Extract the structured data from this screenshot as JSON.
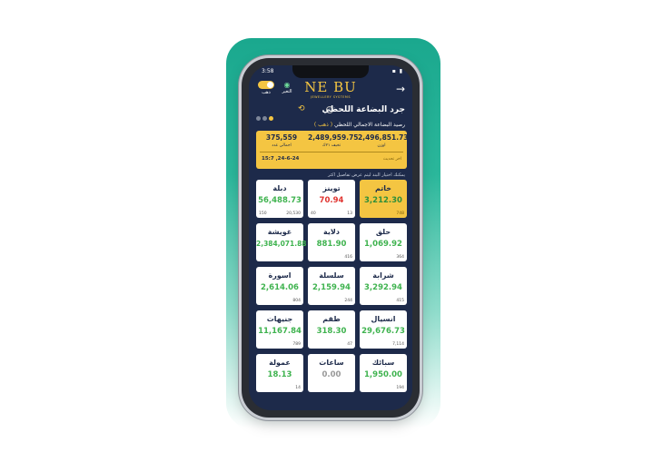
{
  "status": {
    "time": "3:58",
    "icons": "▪ ▮"
  },
  "header": {
    "logo": "NE BU",
    "logo_sub": "JEWELLERY SYSTEMS",
    "eye_label": "التغير",
    "toggle_label": "ذهب",
    "arrow": "→"
  },
  "title": {
    "text": "جرد البضاعة اللحظي",
    "info": "i"
  },
  "subtitle": {
    "text": "رصيد البضاعة الاجمالي اللحظي",
    "highlight": "( ذهب )"
  },
  "summary": {
    "stats": [
      {
        "value": "2,496,851.73",
        "label": "اوزن"
      },
      {
        "value": "2,489,959.75",
        "label": "تخيف ٢١ك"
      },
      {
        "value": "375,559",
        "label": "اجمالي عدد"
      }
    ],
    "update_label": "اخر تحديث",
    "update_value": "15:7 ,24-6-24"
  },
  "hint": "يمكنك اختيار البند ليتم عرض تفاصيل اكثر",
  "cards": [
    {
      "name": "خاتم",
      "amount": "3,212.30",
      "count": "748",
      "count2": ""
    },
    {
      "name": "توينز",
      "amount": "70.94",
      "count": "13",
      "count2": "40"
    },
    {
      "name": "دبلة",
      "amount": "56,488.73",
      "count": "20,530",
      "count2": "150"
    },
    {
      "name": "حلق",
      "amount": "1,069.92",
      "count": "364",
      "count2": ""
    },
    {
      "name": "دلاية",
      "amount": "881.90",
      "count": "416",
      "count2": ""
    },
    {
      "name": "غويشة",
      "amount": "2,384,071.88",
      "count": "",
      "count2": ""
    },
    {
      "name": "شرابة",
      "amount": "3,292.94",
      "count": "415",
      "count2": ""
    },
    {
      "name": "سلسلة",
      "amount": "2,159.94",
      "count": "244",
      "count2": ""
    },
    {
      "name": "اسورة",
      "amount": "2,614.06",
      "count": "804",
      "count2": ""
    },
    {
      "name": "انسيال",
      "amount": "29,676.73",
      "count": "7,114",
      "count2": ""
    },
    {
      "name": "طقم",
      "amount": "318.30",
      "count": "47",
      "count2": ""
    },
    {
      "name": "جنيهات",
      "amount": "11,167.84",
      "count": "789",
      "count2": ""
    },
    {
      "name": "سبائك",
      "amount": "1,950.00",
      "count": "194",
      "count2": ""
    },
    {
      "name": "ساعات",
      "amount": "0.00",
      "count": "",
      "count2": ""
    },
    {
      "name": "عمولة",
      "amount": "18.13",
      "count": "14",
      "count2": ""
    }
  ],
  "colors": {
    "navy": "#1d2a4a",
    "gold": "#f4c542",
    "green": "#3fb34f",
    "red": "#e0332f",
    "teal": "#1aa88e"
  }
}
